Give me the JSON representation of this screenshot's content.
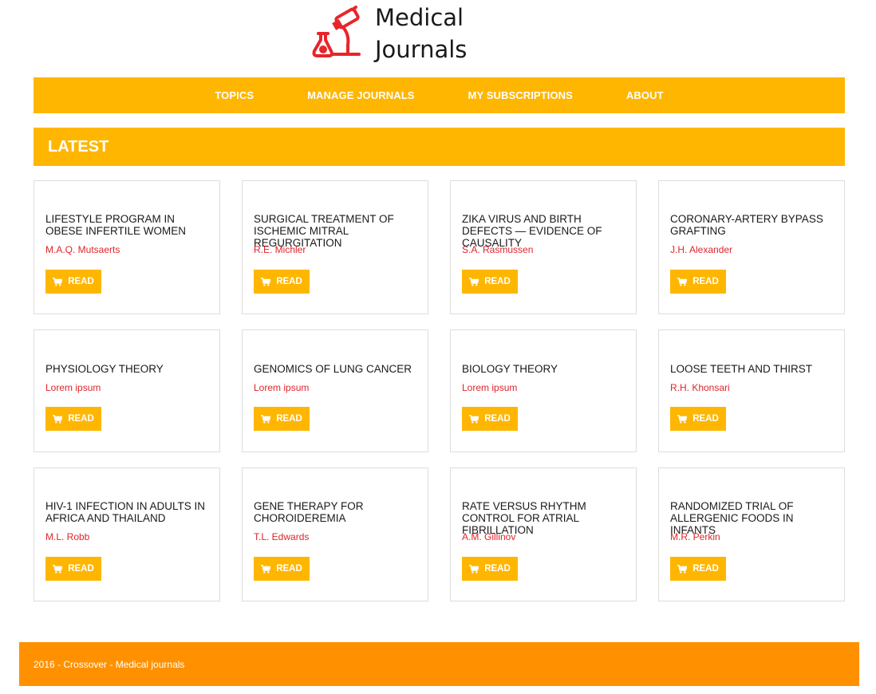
{
  "brand": {
    "line1": "Medical",
    "line2": "Journals"
  },
  "colors": {
    "accent": "#ffb600",
    "footer": "#ff9100",
    "author": "#e0242a",
    "logo": "#e8252b"
  },
  "nav": {
    "items": [
      "TOPICS",
      "MANAGE JOURNALS",
      "MY SUBSCRIPTIONS",
      "ABOUT"
    ]
  },
  "section": {
    "title": "LATEST"
  },
  "read_label": "READ",
  "cards": [
    {
      "title": "LIFESTYLE PROGRAM IN OBESE INFERTILE WOMEN",
      "author": "M.A.Q. Mutsaerts"
    },
    {
      "title": "SURGICAL TREATMENT OF ISCHEMIC MITRAL REGURGITATION",
      "author": "R.E. Michler"
    },
    {
      "title": "ZIKA VIRUS AND BIRTH DEFECTS — EVIDENCE OF CAUSALITY",
      "author": "S.A. Rasmussen"
    },
    {
      "title": "CORONARY-ARTERY BYPASS GRAFTING",
      "author": "J.H. Alexander"
    },
    {
      "title": "PHYSIOLOGY THEORY",
      "author": "Lorem ipsum"
    },
    {
      "title": "GENOMICS OF LUNG CANCER",
      "author": "Lorem ipsum"
    },
    {
      "title": "BIOLOGY THEORY",
      "author": "Lorem ipsum"
    },
    {
      "title": "LOOSE TEETH AND THIRST",
      "author": "R.H. Khonsari"
    },
    {
      "title": "HIV-1 INFECTION IN ADULTS IN AFRICA AND THAILAND",
      "author": "M.L. Robb"
    },
    {
      "title": "GENE THERAPY FOR CHOROIDEREMIA",
      "author": "T.L. Edwards"
    },
    {
      "title": "RATE VERSUS RHYTHM CONTROL FOR ATRIAL FIBRILLATION",
      "author": "A.M. Gillinov"
    },
    {
      "title": "RANDOMIZED TRIAL OF ALLERGENIC FOODS IN INFANTS",
      "author": "M.R. Perkin"
    }
  ],
  "footer": {
    "text": "2016 - Crossover - Medical journals"
  }
}
